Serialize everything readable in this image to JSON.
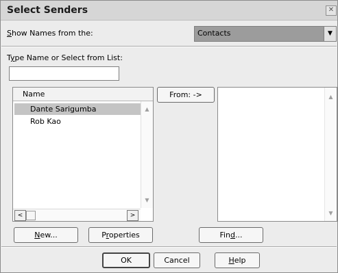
{
  "window": {
    "title": "Select Senders",
    "close_glyph": "✕"
  },
  "show_names": {
    "label_prefix": "S",
    "label_rest": "how Names from the:",
    "value": "Contacts",
    "arrow": "▼"
  },
  "type_name": {
    "label_pre": "T",
    "label_u": "y",
    "label_rest": "pe Name or Select from List:",
    "value": ""
  },
  "list": {
    "column_header": "Name",
    "rows": [
      "Dante Sarigumba",
      "Rob Kao"
    ],
    "selected_index": 0
  },
  "from_button": {
    "label": "From: ->"
  },
  "buttons": {
    "new_u": "N",
    "new_rest": "ew...",
    "prop_pre": "P",
    "prop_u": "r",
    "prop_rest": "operties",
    "find_pre": "Fin",
    "find_u": "d",
    "find_rest": "...",
    "ok": "OK",
    "cancel": "Cancel",
    "help_u": "H",
    "help_rest": "elp"
  },
  "icons": {
    "up_arrow": "▲",
    "down_arrow": "▼",
    "left_arrow": "<",
    "right_arrow": ">"
  }
}
